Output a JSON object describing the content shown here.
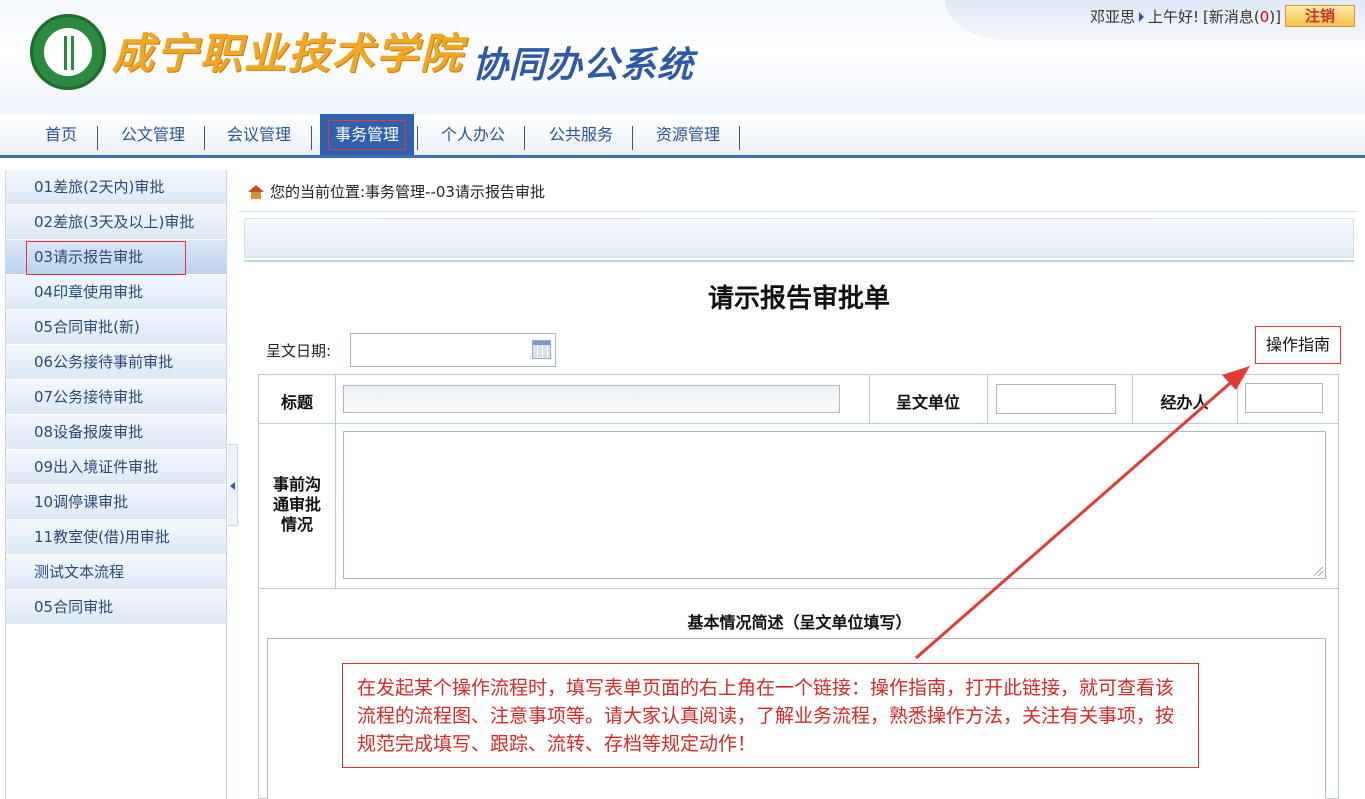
{
  "header": {
    "school_name": "成宁职业技术学院",
    "system_name": "协同办公系统",
    "user_name": "邓亚思",
    "greeting": "上午好!",
    "msg_prefix": "[新消息(",
    "msg_count": "0",
    "msg_suffix": ")]",
    "logout_label": "注销"
  },
  "nav": {
    "items": [
      {
        "label": "首页"
      },
      {
        "label": "公文管理"
      },
      {
        "label": "会议管理"
      },
      {
        "label": "事务管理"
      },
      {
        "label": "个人办公"
      },
      {
        "label": "公共服务"
      },
      {
        "label": "资源管理"
      }
    ],
    "active_index": 3
  },
  "sidebar": {
    "items": [
      {
        "label": "01差旅(2天内)审批"
      },
      {
        "label": "02差旅(3天及以上)审批"
      },
      {
        "label": "03请示报告审批"
      },
      {
        "label": "04印章使用审批"
      },
      {
        "label": "05合同审批(新)"
      },
      {
        "label": "06公务接待事前审批"
      },
      {
        "label": "07公务接待审批"
      },
      {
        "label": "08设备报废审批"
      },
      {
        "label": "09出入境证件审批"
      },
      {
        "label": "10调停课审批"
      },
      {
        "label": "11教室使(借)用审批"
      },
      {
        "label": "测试文本流程"
      },
      {
        "label": "05合同审批"
      }
    ],
    "active_index": 2
  },
  "breadcrumb": {
    "text": "您的当前位置:事务管理--03请示报告审批"
  },
  "form": {
    "title": "请示报告审批单",
    "date_label": "呈文日期:",
    "date_value": "",
    "guide_link": "操作指南",
    "title_label": "标题",
    "title_value": "",
    "unit_label": "呈文单位",
    "unit_value": "",
    "handler_label": "经办人",
    "handler_value": "",
    "prior_label": "事前沟通审批情况",
    "prior_value": "",
    "section_title": "基本情况简述（呈文单位填写）"
  },
  "annotation": {
    "text": "在发起某个操作流程时，填写表单页面的右上角在一个链接：操作指南，打开此链接，就可查看该流程的流程图、注意事项等。请大家认真阅读，了解业务流程，熟悉操作方法，关注有关事项，按规范完成填写、跟踪、流转、存档等规定动作！"
  },
  "colors": {
    "nav_active": "#2f61ae",
    "highlight_border": "#ee3333",
    "annotation_text": "#d42a2a",
    "arrow": "#e53935"
  },
  "icons": {
    "home": "home-icon",
    "calendar": "calendar-icon",
    "userbar_pointer": "triangle-right-icon",
    "collapse": "chevron-left-icon"
  }
}
